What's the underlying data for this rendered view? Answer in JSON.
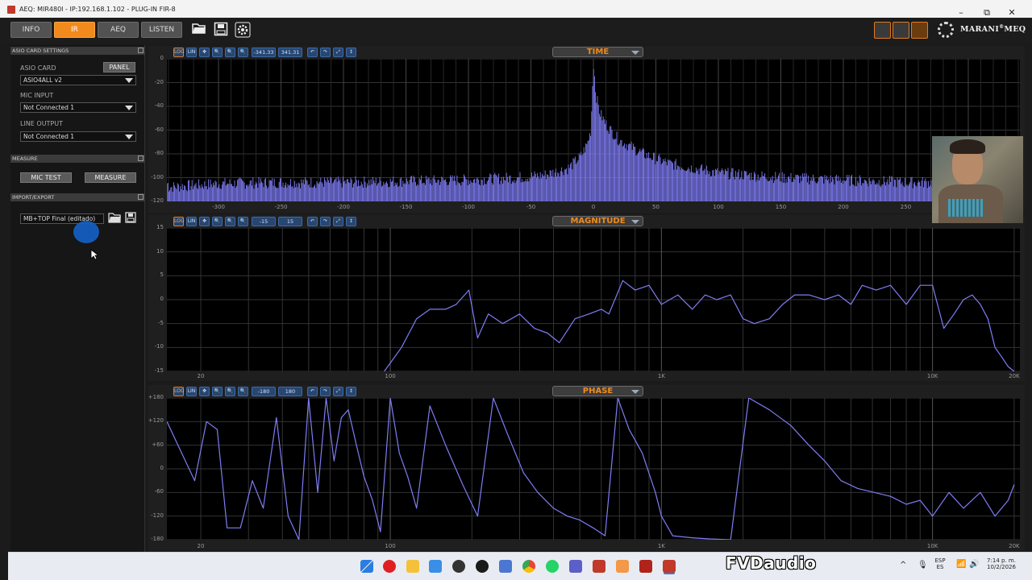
{
  "window": {
    "title": "AEQ: MIR480I - IP:192.168.1.102 - PLUG-IN FIR-8",
    "controls": [
      "–",
      "⧉",
      "✕"
    ]
  },
  "tabs": [
    {
      "label": "INFO",
      "active": false
    },
    {
      "label": "IR",
      "active": true
    },
    {
      "label": "AEQ",
      "active": false
    },
    {
      "label": "LISTEN",
      "active": false
    }
  ],
  "toolbar": {
    "icons": [
      "folder-open-icon",
      "save-icon",
      "settings-icon"
    ]
  },
  "brand": {
    "name": "MARANI",
    "sup": "®",
    "suffix": "MEQ"
  },
  "sidebar": {
    "asio": {
      "header": "ASIO CARD SETTINGS",
      "card_label": "ASIO CARD",
      "panel_button": "PANEL",
      "card_value": "ASIO4ALL v2",
      "mic_label": "MIC INPUT",
      "mic_value": "Not Connected 1",
      "line_label": "LINE OUTPUT",
      "line_value": "Not Connected 1"
    },
    "measure": {
      "header": "MEASURE",
      "mic_test": "MIC TEST",
      "measure": "MEASURE"
    },
    "import_export": {
      "header": "IMPORT/EXPORT",
      "file_value": "MB+TOP Final (editado)"
    }
  },
  "panels": [
    {
      "key": "time",
      "title": "TIME",
      "tools": [
        "LOG",
        "LIN",
        "✥",
        "🔍",
        "🔍",
        "🔍"
      ],
      "min_field": "-341.33",
      "max_field": "341.31",
      "y_ticks": [
        "0",
        "-20",
        "-40",
        "-60",
        "-80",
        "-100",
        "-120"
      ],
      "x_ticks": [
        "-300",
        "-250",
        "-200",
        "-150",
        "-100",
        "-50",
        "0",
        "50",
        "100",
        "150",
        "200",
        "250"
      ]
    },
    {
      "key": "magnitude",
      "title": "MAGNITUDE",
      "tools": [
        "LOG",
        "LIN",
        "✥",
        "🔍",
        "🔍",
        "🔍"
      ],
      "min_field": "-15",
      "max_field": "15",
      "y_ticks": [
        "15",
        "10",
        "5",
        "0",
        "-5",
        "-10",
        "-15"
      ],
      "x_ticks": [
        "20",
        "100",
        "1K",
        "10K",
        "20K"
      ]
    },
    {
      "key": "phase",
      "title": "PHASE",
      "tools": [
        "LOG",
        "LIN",
        "✥",
        "🔍",
        "🔍",
        "🔍"
      ],
      "min_field": "-180",
      "max_field": "180",
      "y_ticks": [
        "+180",
        "+120",
        "+60",
        "0",
        "-60",
        "-120",
        "-180"
      ],
      "x_ticks": [
        "20",
        "100",
        "1K",
        "10K",
        "20K"
      ]
    }
  ],
  "chart_data": [
    {
      "type": "line",
      "title": "TIME",
      "xlabel": "",
      "ylabel": "",
      "xlim": [
        -341.33,
        341.31
      ],
      "ylim": [
        -120,
        0
      ],
      "x": [
        -340,
        -300,
        -250,
        -200,
        -150,
        -100,
        -60,
        -40,
        -20,
        -10,
        -5,
        -2,
        0,
        2,
        5,
        10,
        20,
        40,
        60,
        100,
        150,
        200,
        250,
        300,
        340
      ],
      "values": [
        -108,
        -105,
        -104,
        -104,
        -103,
        -102,
        -100,
        -98,
        -92,
        -82,
        -72,
        -60,
        -3,
        -30,
        -45,
        -55,
        -68,
        -80,
        -88,
        -96,
        -100,
        -102,
        -104,
        -104,
        -105
      ],
      "color": "#7f7df5"
    },
    {
      "type": "line",
      "title": "MAGNITUDE",
      "xlabel": "",
      "ylabel": "",
      "x_scale": "log",
      "xlim": [
        15,
        21000
      ],
      "ylim": [
        -15,
        15
      ],
      "x": [
        95,
        110,
        125,
        140,
        160,
        175,
        195,
        210,
        230,
        260,
        300,
        340,
        380,
        420,
        480,
        540,
        600,
        640,
        720,
        800,
        900,
        1000,
        1150,
        1300,
        1450,
        1600,
        1800,
        2000,
        2200,
        2500,
        2800,
        3100,
        3500,
        4000,
        4500,
        5000,
        5500,
        6200,
        7000,
        8000,
        9000,
        10000,
        11000,
        12000,
        13000,
        14000,
        15000,
        16000,
        17000,
        18000,
        19000,
        20000
      ],
      "values": [
        -15,
        -10,
        -4,
        -2,
        -2,
        -1,
        2,
        -8,
        -3,
        -5,
        -3,
        -6,
        -7,
        -9,
        -4,
        -3,
        -2,
        -3,
        4,
        2,
        3,
        -1,
        1,
        -2,
        1,
        0,
        1,
        -4,
        -5,
        -4,
        -1,
        1,
        1,
        0,
        1,
        -1,
        3,
        2,
        3,
        -1,
        3,
        3,
        -6,
        -3,
        0,
        1,
        -1,
        -4,
        -10,
        -12,
        -14,
        -15
      ],
      "color": "#7f7df5"
    },
    {
      "type": "line",
      "title": "PHASE",
      "xlabel": "",
      "ylabel": "",
      "x_scale": "log",
      "xlim": [
        15,
        21000
      ],
      "ylim": [
        -180,
        180
      ],
      "x": [
        15,
        17,
        19,
        21,
        23,
        25,
        28,
        31,
        34,
        38,
        42,
        46,
        50,
        54,
        58,
        62,
        66,
        70,
        75,
        80,
        86,
        92,
        100,
        108,
        116,
        125,
        140,
        160,
        185,
        210,
        240,
        270,
        310,
        350,
        400,
        450,
        500,
        560,
        620,
        690,
        760,
        850,
        950,
        1000,
        1100,
        1300,
        1500,
        1800,
        2100,
        2500,
        3000,
        3500,
        4000,
        4600,
        5300,
        6100,
        7000,
        8000,
        9000,
        10000,
        11500,
        13000,
        15000,
        17000,
        19000,
        20000
      ],
      "values": [
        120,
        40,
        -30,
        120,
        100,
        -150,
        -150,
        -30,
        -100,
        130,
        -120,
        -180,
        180,
        -60,
        180,
        20,
        130,
        150,
        60,
        -20,
        -80,
        -160,
        180,
        40,
        -20,
        -100,
        160,
        60,
        -40,
        -120,
        180,
        90,
        -10,
        -60,
        -100,
        -120,
        -130,
        -150,
        -170,
        180,
        100,
        40,
        -60,
        -120,
        -170,
        -175,
        -178,
        -180,
        180,
        150,
        110,
        60,
        20,
        -30,
        -50,
        -60,
        -70,
        -90,
        -80,
        -120,
        -60,
        -100,
        -60,
        -120,
        -80,
        -40
      ],
      "color": "#7f7df5"
    }
  ],
  "taskbar": {
    "watermark": "FVDaudio",
    "lang_top": "ESP",
    "lang_bottom": "ES",
    "time": "7:14 p. m.",
    "date": "10/2/2026"
  }
}
